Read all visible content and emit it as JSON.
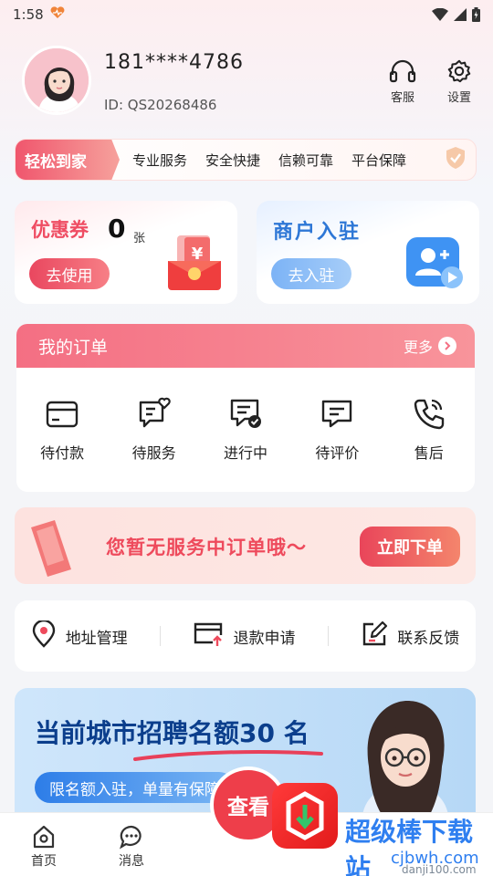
{
  "status": {
    "time": "1:58"
  },
  "profile": {
    "phone": "181****4786",
    "id_label": "ID: QS20268486",
    "service_label": "客服",
    "settings_label": "设置"
  },
  "slogan": {
    "tag": "轻松到家",
    "items": [
      "专业服务",
      "安全快捷",
      "信赖可靠",
      "平台保障"
    ]
  },
  "coupon": {
    "title": "优惠券",
    "count": "0",
    "unit": "张",
    "button": "去使用"
  },
  "merchant": {
    "title": "商户入驻",
    "button": "去入驻"
  },
  "orders": {
    "title": "我的订单",
    "more": "更多",
    "items": [
      {
        "label": "待付款",
        "icon": "card-icon"
      },
      {
        "label": "待服务",
        "icon": "heart-chat-icon"
      },
      {
        "label": "进行中",
        "icon": "check-chat-icon"
      },
      {
        "label": "待评价",
        "icon": "comment-icon"
      },
      {
        "label": "售后",
        "icon": "phone-icon"
      }
    ]
  },
  "promo": {
    "text": "您暂无服务中订单哦～",
    "button": "立即下单"
  },
  "tools": [
    {
      "label": "地址管理",
      "icon": "location-icon"
    },
    {
      "label": "退款申请",
      "icon": "refund-icon"
    },
    {
      "label": "联系反馈",
      "icon": "edit-icon"
    }
  ],
  "recruit": {
    "title_prefix": "当前城市",
    "title_em": "招聘名额",
    "title_num": "30",
    "title_suffix": " 名",
    "subtitle": "限名额入驻，单量有保障"
  },
  "tabbar": {
    "home": "首页",
    "messages": "消息"
  },
  "watermark": {
    "bubble": "查看",
    "brand": "超级棒下载站",
    "url": "cjbwh.com",
    "url2": "danji100.com"
  },
  "colors": {
    "accent_red": "#ef4d63",
    "accent_blue": "#2e77d6",
    "navy": "#0b3e8c"
  }
}
